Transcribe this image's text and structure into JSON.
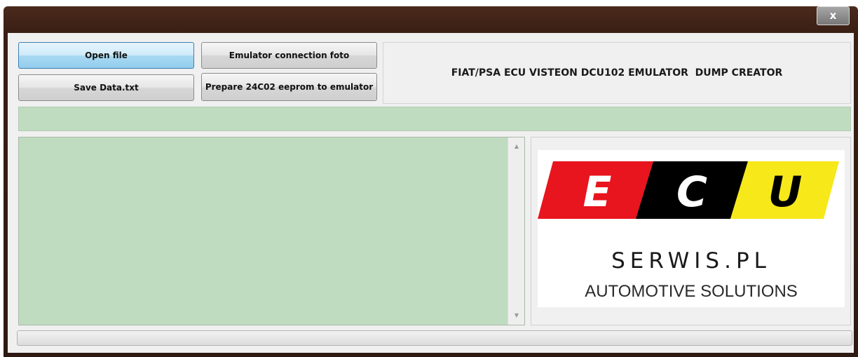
{
  "window": {
    "close_label": "x"
  },
  "toolbar": {
    "open_file": "Open file",
    "save_data": "Save Data.txt",
    "emulator_photo": "Emulator connection foto",
    "prepare_eeprom": "Prepare 24C02 eeprom to emulator"
  },
  "header": {
    "title": "FIAT/PSA ECU VISTEON DCU102 EMULATOR  DUMP CREATOR"
  },
  "status": {
    "text": ""
  },
  "memo": {
    "text": ""
  },
  "logo": {
    "letters": [
      "E",
      "C",
      "U"
    ],
    "line1": "SERWIS.PL",
    "line2": "AUTOMOTIVE SOLUTIONS",
    "colors": {
      "red": "#e8141e",
      "black": "#000000",
      "yellow": "#f7e81a"
    }
  },
  "progress": {
    "value": 0
  },
  "colors": {
    "panel_green": "#c0dcc0",
    "title_bar": "#3a1f14"
  }
}
